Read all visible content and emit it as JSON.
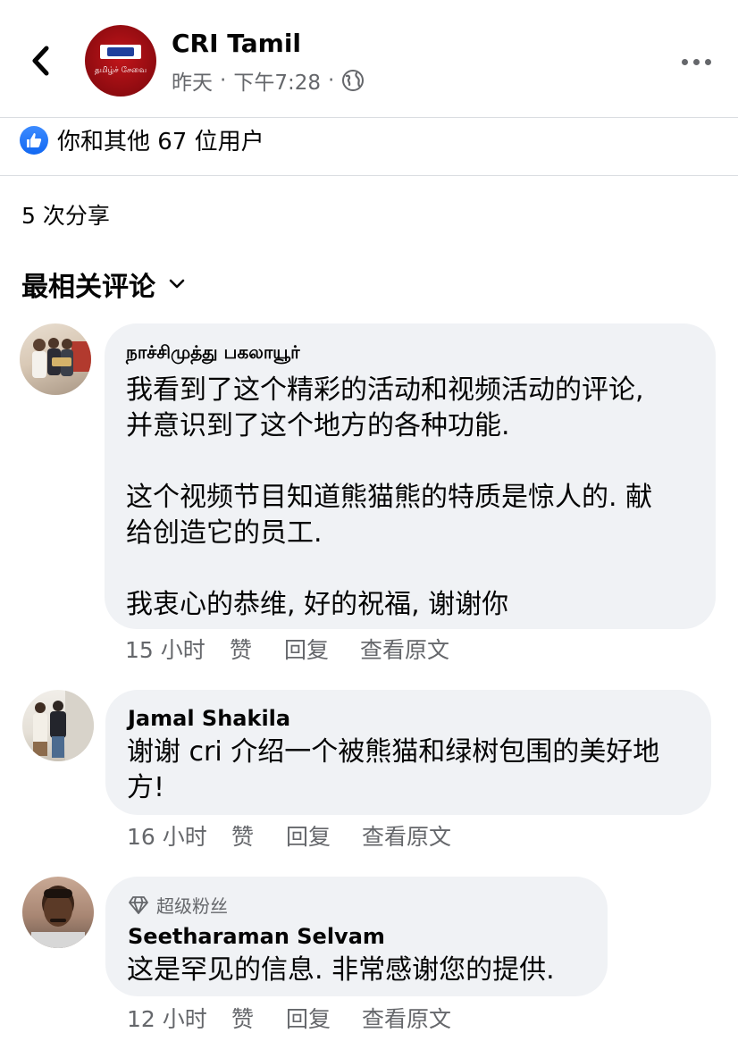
{
  "header": {
    "page_name": "CRI Tamil",
    "avatar_logo_text": "தமிழ்ச் சேவை",
    "meta_day": "昨天",
    "meta_sep1": "·",
    "meta_time": "下午7:28",
    "meta_sep2": "·",
    "privacy_icon": "globe-icon",
    "more_icon": "more-horizontal-icon",
    "back_icon": "chevron-left-icon"
  },
  "reactions": {
    "icon": "like-thumb-icon",
    "text": "你和其他 67 位用户",
    "color": "#1877f2"
  },
  "shares": {
    "text": "5 次分享"
  },
  "sort": {
    "label": "最相关评论",
    "icon": "chevron-down-icon"
  },
  "comments": [
    {
      "author": "நாச்சிமுத்து பகலாயூர்",
      "lines": [
        "我看到了这个精彩的活动和视频活动的评论,",
        "并意识到了这个地方的各种功能.",
        "",
        "这个视频节目知道熊猫熊的特质是惊人的. 献",
        "给创造它的员工.",
        "",
        "我衷心的恭维, 好的祝福, 谢谢你"
      ],
      "time": "15 小时",
      "like": "赞",
      "reply": "回复",
      "translate": "查看原文"
    },
    {
      "author": "Jamal Shakila",
      "lines": [
        "谢谢 cri 介绍一个被熊猫和绿树包围的美好地",
        "方!"
      ],
      "time": "16 小时",
      "like": "赞",
      "reply": "回复",
      "translate": "查看原文"
    },
    {
      "badge": "超级粉丝",
      "badge_icon": "diamond-icon",
      "author": "Seetharaman Selvam",
      "lines": [
        "这是罕见的信息. 非常感谢您的提供."
      ],
      "time": "12 小时",
      "like": "赞",
      "reply": "回复",
      "translate": "查看原文"
    }
  ]
}
